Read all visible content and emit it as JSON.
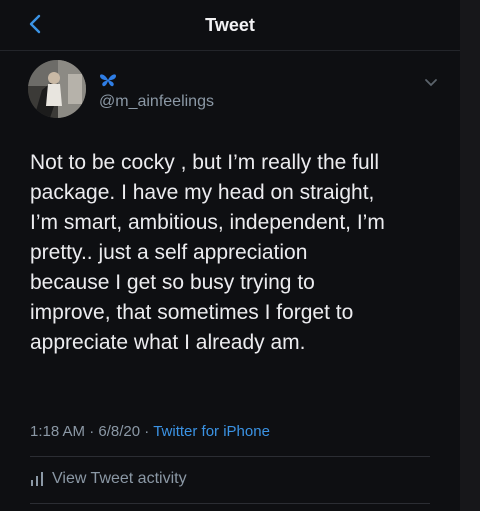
{
  "header": {
    "title": "Tweet"
  },
  "user": {
    "name_emoji": "butterfly",
    "handle": "@m_ainfeelings"
  },
  "tweet": {
    "text": "Not to be cocky , but I’m really the full\npackage. I have my head on straight,\nI’m smart, ambitious, independent, I’m\npretty.. just a self appreciation\nbecause I get so busy trying to\nimprove, that sometimes I forget to\nappreciate what I already am."
  },
  "meta": {
    "time": "1:18 AM",
    "date": "6/8/20",
    "separator": "·",
    "source": "Twitter for iPhone"
  },
  "activity": {
    "label": "View Tweet activity"
  },
  "icons": [
    "back-chevron-icon",
    "butterfly-icon",
    "chevron-down-icon",
    "activity-bars-icon"
  ],
  "colors": {
    "background": "#0e0f12",
    "accent": "#3b93e4",
    "muted": "#8b98a5",
    "butterfly": "#2f7ee6"
  }
}
